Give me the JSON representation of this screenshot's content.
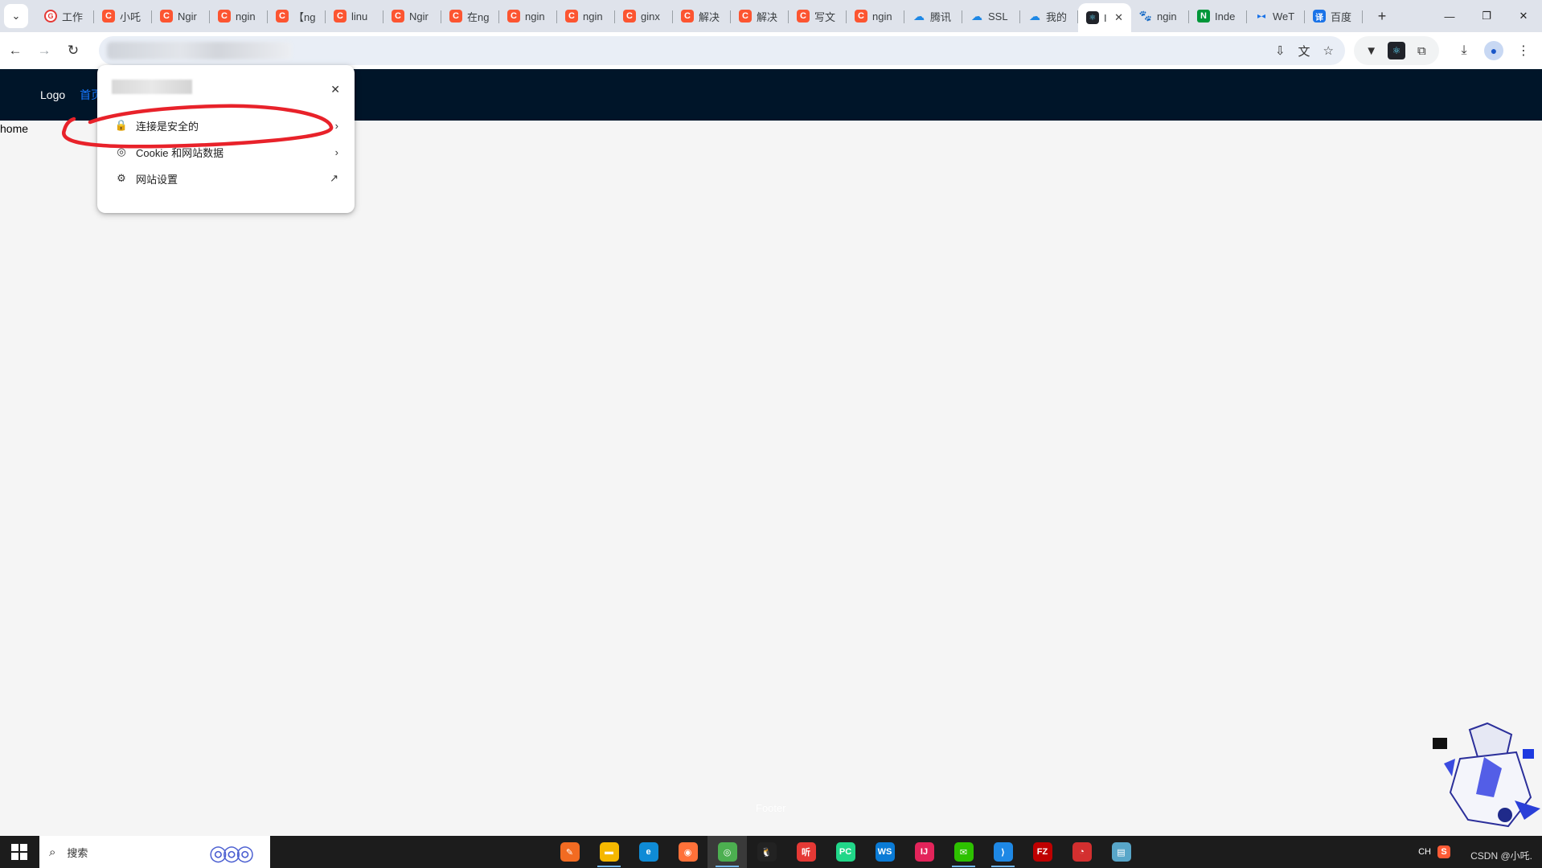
{
  "colors": {
    "tabstrip_bg": "#dfe3eb",
    "site_header_bg": "#001529",
    "site_nav_link": "#1677ff",
    "annotation_red": "#e8222a",
    "taskbar_bg": "#1c1c1c"
  },
  "browser": {
    "tab_search_icon": "chevron-down-icon",
    "tabs": [
      {
        "label": "工作",
        "favicon": "G",
        "style": "fav-g"
      },
      {
        "label": "小吒",
        "favicon": "C",
        "style": "fav-c"
      },
      {
        "label": "Ngir",
        "favicon": "C",
        "style": "fav-c"
      },
      {
        "label": "ngin",
        "favicon": "C",
        "style": "fav-c"
      },
      {
        "label": "【ng",
        "favicon": "C",
        "style": "fav-c"
      },
      {
        "label": "linu",
        "favicon": "C",
        "style": "fav-c"
      },
      {
        "label": "Ngir",
        "favicon": "C",
        "style": "fav-c"
      },
      {
        "label": "在ng",
        "favicon": "C",
        "style": "fav-c"
      },
      {
        "label": "ngin",
        "favicon": "C",
        "style": "fav-c"
      },
      {
        "label": "ngin",
        "favicon": "C",
        "style": "fav-c"
      },
      {
        "label": "ginx",
        "favicon": "C",
        "style": "fav-c"
      },
      {
        "label": "解决",
        "favicon": "C",
        "style": "fav-c"
      },
      {
        "label": "解决",
        "favicon": "C",
        "style": "fav-c"
      },
      {
        "label": "写文",
        "favicon": "C",
        "style": "fav-c"
      },
      {
        "label": "ngin",
        "favicon": "C",
        "style": "fav-c"
      },
      {
        "label": "腾讯",
        "favicon": "☁",
        "style": "fav-cloud"
      },
      {
        "label": "SSL",
        "favicon": "☁",
        "style": "fav-cloud"
      },
      {
        "label": "我的",
        "favicon": "☁",
        "style": "fav-cloud"
      },
      {
        "label": "I",
        "favicon": "⚛",
        "style": "fav-react",
        "active": true
      },
      {
        "label": "ngin",
        "favicon": "🐾",
        "style": "fav-paw"
      },
      {
        "label": "Inde",
        "favicon": "N",
        "style": "fav-n"
      },
      {
        "label": "WeT",
        "favicon": "▸◂",
        "style": "fav-arrow"
      },
      {
        "label": "百度",
        "favicon": "译",
        "style": "fav-fanyi"
      }
    ],
    "tab_close_glyph": "✕",
    "new_tab_glyph": "+",
    "window_controls": {
      "minimize": "—",
      "restore": "❐",
      "close": "✕"
    },
    "nav": {
      "back": "←",
      "forward": "→",
      "reload": "↻"
    },
    "omnibox_icons": {
      "install": "⇩",
      "translate": "文",
      "bookmark": "☆"
    },
    "extensions": {
      "vue": "▼",
      "react": "⚛",
      "puzzle": "⧉"
    },
    "toolbar_right": {
      "download": "⤓",
      "profile": "●",
      "menu": "⋮"
    }
  },
  "page": {
    "logo": "Logo",
    "nav_home": "首页",
    "content": "home",
    "footer": "Footer"
  },
  "site_info_popup": {
    "close_glyph": "✕",
    "rows": [
      {
        "label": "连接是安全的",
        "icon": "lock-icon",
        "glyph": "🔒",
        "end": "›"
      },
      {
        "label": "Cookie 和网站数据",
        "icon": "cookie-icon",
        "glyph": "◎",
        "end": "›"
      },
      {
        "label": "网站设置",
        "icon": "gear-icon",
        "glyph": "⚙",
        "end": "↗"
      }
    ]
  },
  "taskbar": {
    "search_placeholder": "搜索",
    "search_glyph": "⌕",
    "apps": [
      {
        "name": "app-pencil",
        "glyph": "✎",
        "bg": "#f26b22",
        "open": false
      },
      {
        "name": "app-file-explorer",
        "glyph": "▬",
        "bg": "#f5b800",
        "open": true
      },
      {
        "name": "app-edge",
        "glyph": "e",
        "bg": "#0f8bd6",
        "open": false
      },
      {
        "name": "app-firefox",
        "glyph": "◉",
        "bg": "#ff7139",
        "open": false
      },
      {
        "name": "app-chrome",
        "glyph": "◎",
        "bg": "#4caf50",
        "open": true,
        "active": true
      },
      {
        "name": "app-qq",
        "glyph": "🐧",
        "bg": "#222222",
        "open": false
      },
      {
        "name": "app-ting",
        "glyph": "听",
        "bg": "#e53935",
        "open": false
      },
      {
        "name": "app-pycharm",
        "glyph": "PC",
        "bg": "#21d789",
        "open": false
      },
      {
        "name": "app-webstorm",
        "glyph": "WS",
        "bg": "#0a7bd6",
        "open": false
      },
      {
        "name": "app-intellij",
        "glyph": "IJ",
        "bg": "#e3245a",
        "open": false
      },
      {
        "name": "app-wechat",
        "glyph": "✉",
        "bg": "#2dc100",
        "open": true
      },
      {
        "name": "app-vscode",
        "glyph": "⟩",
        "bg": "#1e88e5",
        "open": true
      },
      {
        "name": "app-filezilla",
        "glyph": "FZ",
        "bg": "#bf0000",
        "open": false
      },
      {
        "name": "app-snail",
        "glyph": "◔",
        "bg": "#d32f2f",
        "open": false
      },
      {
        "name": "app-notes",
        "glyph": "▤",
        "bg": "#58a6c9",
        "open": false
      }
    ],
    "tray_lang": "CH",
    "tray_ime": "S"
  },
  "watermark": "CSDN @小吒."
}
